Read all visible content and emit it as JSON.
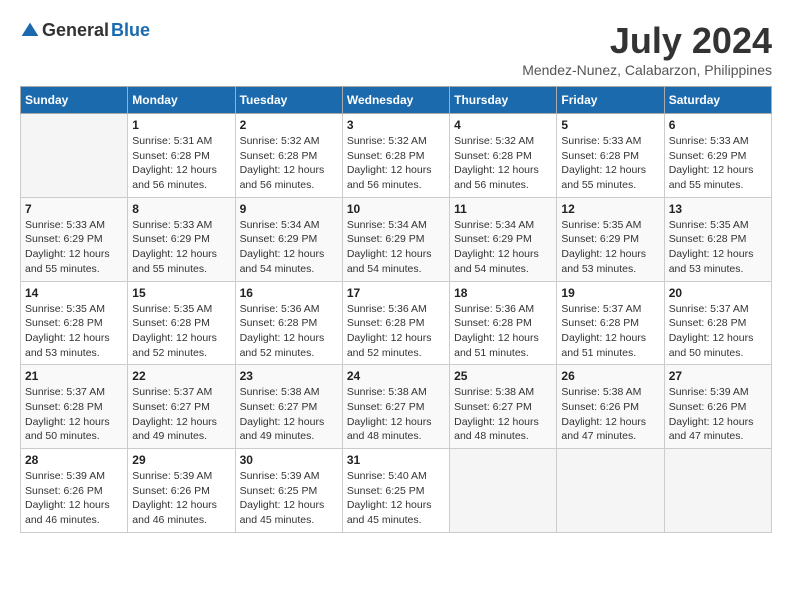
{
  "header": {
    "logo_general": "General",
    "logo_blue": "Blue",
    "title": "July 2024",
    "subtitle": "Mendez-Nunez, Calabarzon, Philippines"
  },
  "weekdays": [
    "Sunday",
    "Monday",
    "Tuesday",
    "Wednesday",
    "Thursday",
    "Friday",
    "Saturday"
  ],
  "weeks": [
    [
      {
        "day": "",
        "info": ""
      },
      {
        "day": "1",
        "info": "Sunrise: 5:31 AM\nSunset: 6:28 PM\nDaylight: 12 hours\nand 56 minutes."
      },
      {
        "day": "2",
        "info": "Sunrise: 5:32 AM\nSunset: 6:28 PM\nDaylight: 12 hours\nand 56 minutes."
      },
      {
        "day": "3",
        "info": "Sunrise: 5:32 AM\nSunset: 6:28 PM\nDaylight: 12 hours\nand 56 minutes."
      },
      {
        "day": "4",
        "info": "Sunrise: 5:32 AM\nSunset: 6:28 PM\nDaylight: 12 hours\nand 56 minutes."
      },
      {
        "day": "5",
        "info": "Sunrise: 5:33 AM\nSunset: 6:28 PM\nDaylight: 12 hours\nand 55 minutes."
      },
      {
        "day": "6",
        "info": "Sunrise: 5:33 AM\nSunset: 6:29 PM\nDaylight: 12 hours\nand 55 minutes."
      }
    ],
    [
      {
        "day": "7",
        "info": "Sunrise: 5:33 AM\nSunset: 6:29 PM\nDaylight: 12 hours\nand 55 minutes."
      },
      {
        "day": "8",
        "info": "Sunrise: 5:33 AM\nSunset: 6:29 PM\nDaylight: 12 hours\nand 55 minutes."
      },
      {
        "day": "9",
        "info": "Sunrise: 5:34 AM\nSunset: 6:29 PM\nDaylight: 12 hours\nand 54 minutes."
      },
      {
        "day": "10",
        "info": "Sunrise: 5:34 AM\nSunset: 6:29 PM\nDaylight: 12 hours\nand 54 minutes."
      },
      {
        "day": "11",
        "info": "Sunrise: 5:34 AM\nSunset: 6:29 PM\nDaylight: 12 hours\nand 54 minutes."
      },
      {
        "day": "12",
        "info": "Sunrise: 5:35 AM\nSunset: 6:29 PM\nDaylight: 12 hours\nand 53 minutes."
      },
      {
        "day": "13",
        "info": "Sunrise: 5:35 AM\nSunset: 6:28 PM\nDaylight: 12 hours\nand 53 minutes."
      }
    ],
    [
      {
        "day": "14",
        "info": "Sunrise: 5:35 AM\nSunset: 6:28 PM\nDaylight: 12 hours\nand 53 minutes."
      },
      {
        "day": "15",
        "info": "Sunrise: 5:35 AM\nSunset: 6:28 PM\nDaylight: 12 hours\nand 52 minutes."
      },
      {
        "day": "16",
        "info": "Sunrise: 5:36 AM\nSunset: 6:28 PM\nDaylight: 12 hours\nand 52 minutes."
      },
      {
        "day": "17",
        "info": "Sunrise: 5:36 AM\nSunset: 6:28 PM\nDaylight: 12 hours\nand 52 minutes."
      },
      {
        "day": "18",
        "info": "Sunrise: 5:36 AM\nSunset: 6:28 PM\nDaylight: 12 hours\nand 51 minutes."
      },
      {
        "day": "19",
        "info": "Sunrise: 5:37 AM\nSunset: 6:28 PM\nDaylight: 12 hours\nand 51 minutes."
      },
      {
        "day": "20",
        "info": "Sunrise: 5:37 AM\nSunset: 6:28 PM\nDaylight: 12 hours\nand 50 minutes."
      }
    ],
    [
      {
        "day": "21",
        "info": "Sunrise: 5:37 AM\nSunset: 6:28 PM\nDaylight: 12 hours\nand 50 minutes."
      },
      {
        "day": "22",
        "info": "Sunrise: 5:37 AM\nSunset: 6:27 PM\nDaylight: 12 hours\nand 49 minutes."
      },
      {
        "day": "23",
        "info": "Sunrise: 5:38 AM\nSunset: 6:27 PM\nDaylight: 12 hours\nand 49 minutes."
      },
      {
        "day": "24",
        "info": "Sunrise: 5:38 AM\nSunset: 6:27 PM\nDaylight: 12 hours\nand 48 minutes."
      },
      {
        "day": "25",
        "info": "Sunrise: 5:38 AM\nSunset: 6:27 PM\nDaylight: 12 hours\nand 48 minutes."
      },
      {
        "day": "26",
        "info": "Sunrise: 5:38 AM\nSunset: 6:26 PM\nDaylight: 12 hours\nand 47 minutes."
      },
      {
        "day": "27",
        "info": "Sunrise: 5:39 AM\nSunset: 6:26 PM\nDaylight: 12 hours\nand 47 minutes."
      }
    ],
    [
      {
        "day": "28",
        "info": "Sunrise: 5:39 AM\nSunset: 6:26 PM\nDaylight: 12 hours\nand 46 minutes."
      },
      {
        "day": "29",
        "info": "Sunrise: 5:39 AM\nSunset: 6:26 PM\nDaylight: 12 hours\nand 46 minutes."
      },
      {
        "day": "30",
        "info": "Sunrise: 5:39 AM\nSunset: 6:25 PM\nDaylight: 12 hours\nand 45 minutes."
      },
      {
        "day": "31",
        "info": "Sunrise: 5:40 AM\nSunset: 6:25 PM\nDaylight: 12 hours\nand 45 minutes."
      },
      {
        "day": "",
        "info": ""
      },
      {
        "day": "",
        "info": ""
      },
      {
        "day": "",
        "info": ""
      }
    ]
  ]
}
